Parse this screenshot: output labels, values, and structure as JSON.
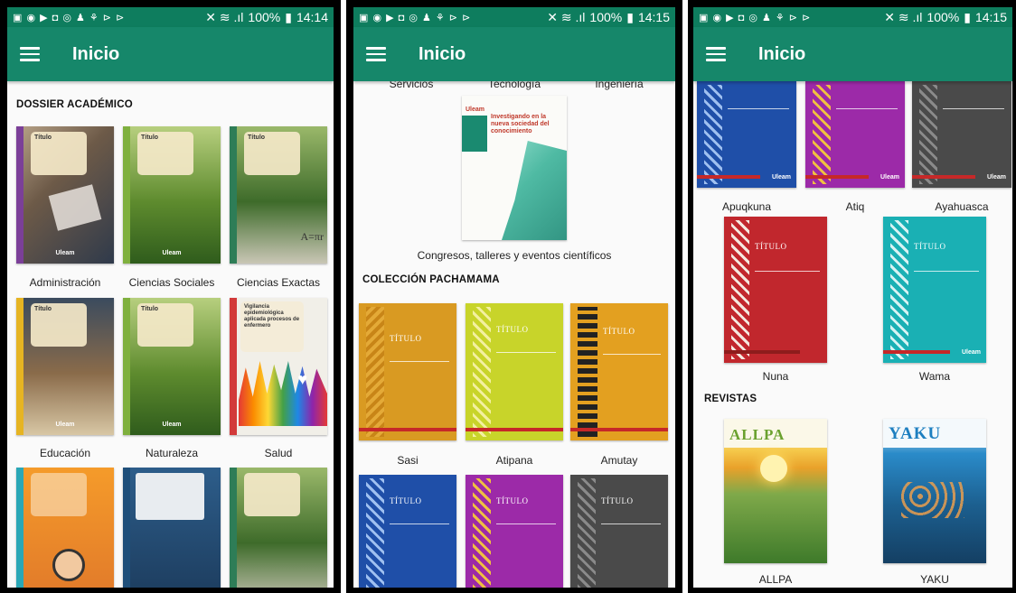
{
  "status": {
    "icons": "▣ ◉ ▶ ◘ ◎ ♟ ⚘ ⊳ ⊳",
    "signal": "✕ ≋ .ıl",
    "battery": "100%",
    "time_1": "14:14",
    "time_2": "14:15",
    "time_3": "14:15"
  },
  "appbar": {
    "title": "Inicio"
  },
  "screen1": {
    "section": "DOSSIER ACADÉMICO",
    "items": [
      {
        "label": "Administración",
        "card": "Título"
      },
      {
        "label": "Ciencias Sociales",
        "card": "Título"
      },
      {
        "label": "Ciencias Exactas",
        "card": "Título"
      },
      {
        "label": "Educación",
        "card": "Título"
      },
      {
        "label": "Naturaleza",
        "card": "Título"
      },
      {
        "label": "Salud",
        "card": "Vigilancia epidemiológica aplicada procesos de enfermero"
      }
    ]
  },
  "screen2": {
    "top_labels": [
      "Servicios",
      "Tecnología",
      "Ingeniería"
    ],
    "featured_title": "Investigando en la nueva sociedad del conocimiento",
    "featured_caption": "Congresos, talleres y eventos científicos",
    "section": "COLECCIÓN PACHAMAMA",
    "items": [
      {
        "label": "Sasi"
      },
      {
        "label": "Atipana"
      },
      {
        "label": "Amutay"
      }
    ],
    "cover_title": "TÍTULO"
  },
  "screen3": {
    "items_top": [
      {
        "label": "Apuqkuna"
      },
      {
        "label": "Atiq"
      },
      {
        "label": "Ayahuasca"
      }
    ],
    "items_mid": [
      {
        "label": "Nuna"
      },
      {
        "label": "Wama"
      }
    ],
    "section": "REVISTAS",
    "revistas": [
      {
        "label": "ALLPA",
        "masthead": "ALLPA"
      },
      {
        "label": "YAKU",
        "masthead": "YAKU"
      }
    ],
    "cover_title": "TÍTULO",
    "logo": "Uleam"
  },
  "colors": {
    "appbar": "#16876a",
    "statusbar": "#0e7d5e"
  }
}
